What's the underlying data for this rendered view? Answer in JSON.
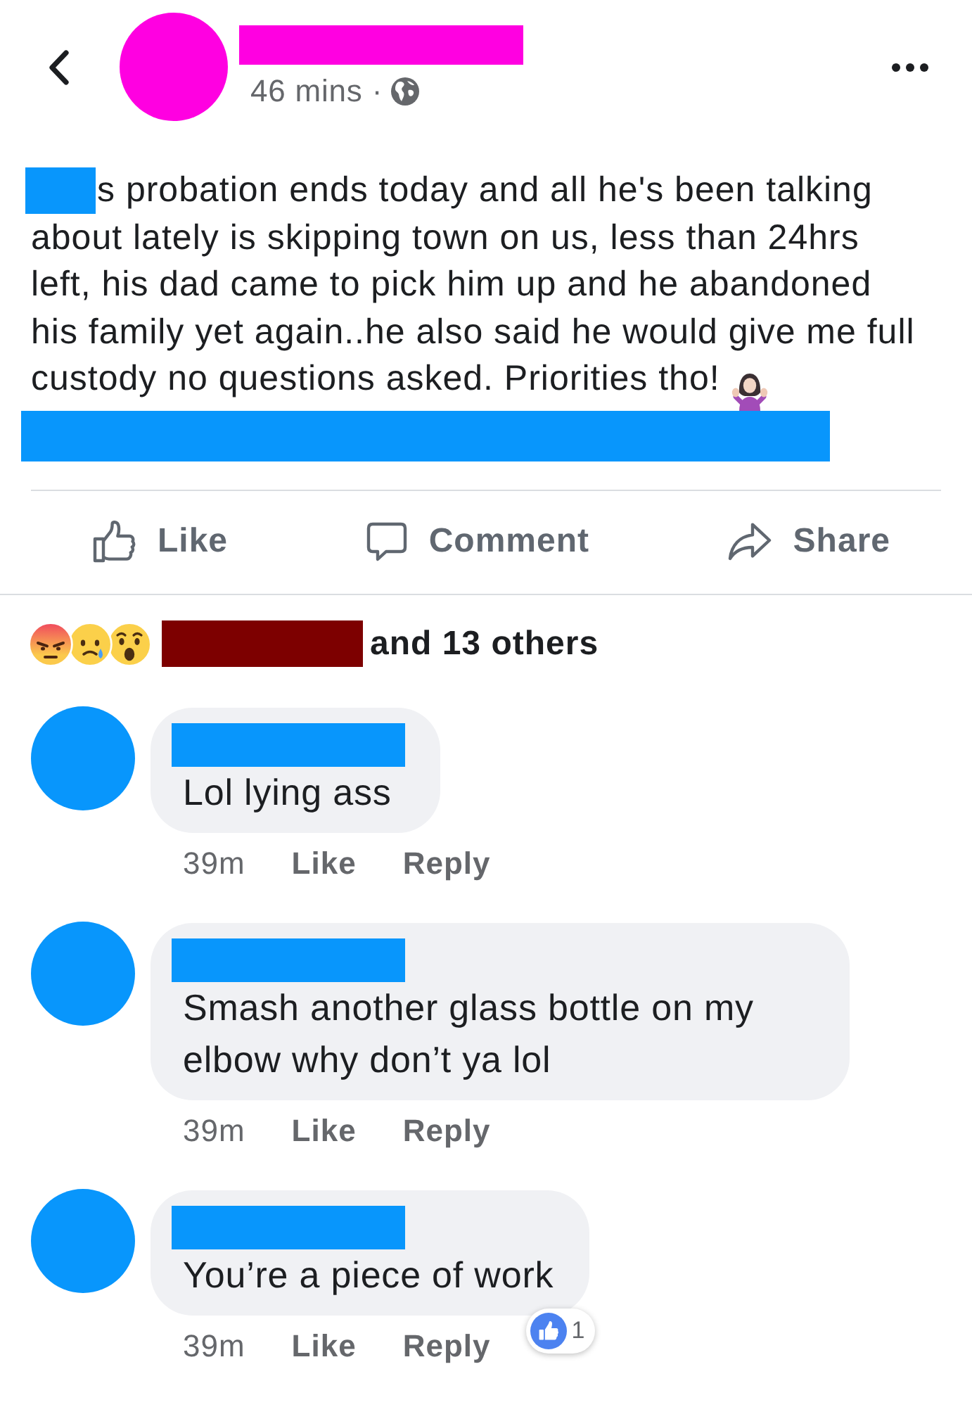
{
  "header": {
    "time": "46 mins ·"
  },
  "post": {
    "text": "s probation ends today and all he's been talking about lately is skipping town on us, less than 24hrs left, his dad came to pick him up and he abandoned his family yet again..he also said he would give me full custody no questions asked. Priorities tho!",
    "actions": [
      {
        "kind": "like",
        "label": "Like"
      },
      {
        "kind": "comment",
        "label": "Comment"
      },
      {
        "kind": "share",
        "label": "Share"
      }
    ]
  },
  "reactions": {
    "summary": "and 13 others"
  },
  "comments": [
    {
      "text": "Lol lying ass",
      "time": "39m",
      "like": "Like",
      "reply": "Reply"
    },
    {
      "text": "Smash another glass bottle on my elbow why don’t ya lol",
      "time": "39m",
      "like": "Like",
      "reply": "Reply"
    },
    {
      "text": "You’re a piece of work",
      "time": "39m",
      "like": "Like",
      "reply": "Reply",
      "like_count": "1"
    }
  ]
}
